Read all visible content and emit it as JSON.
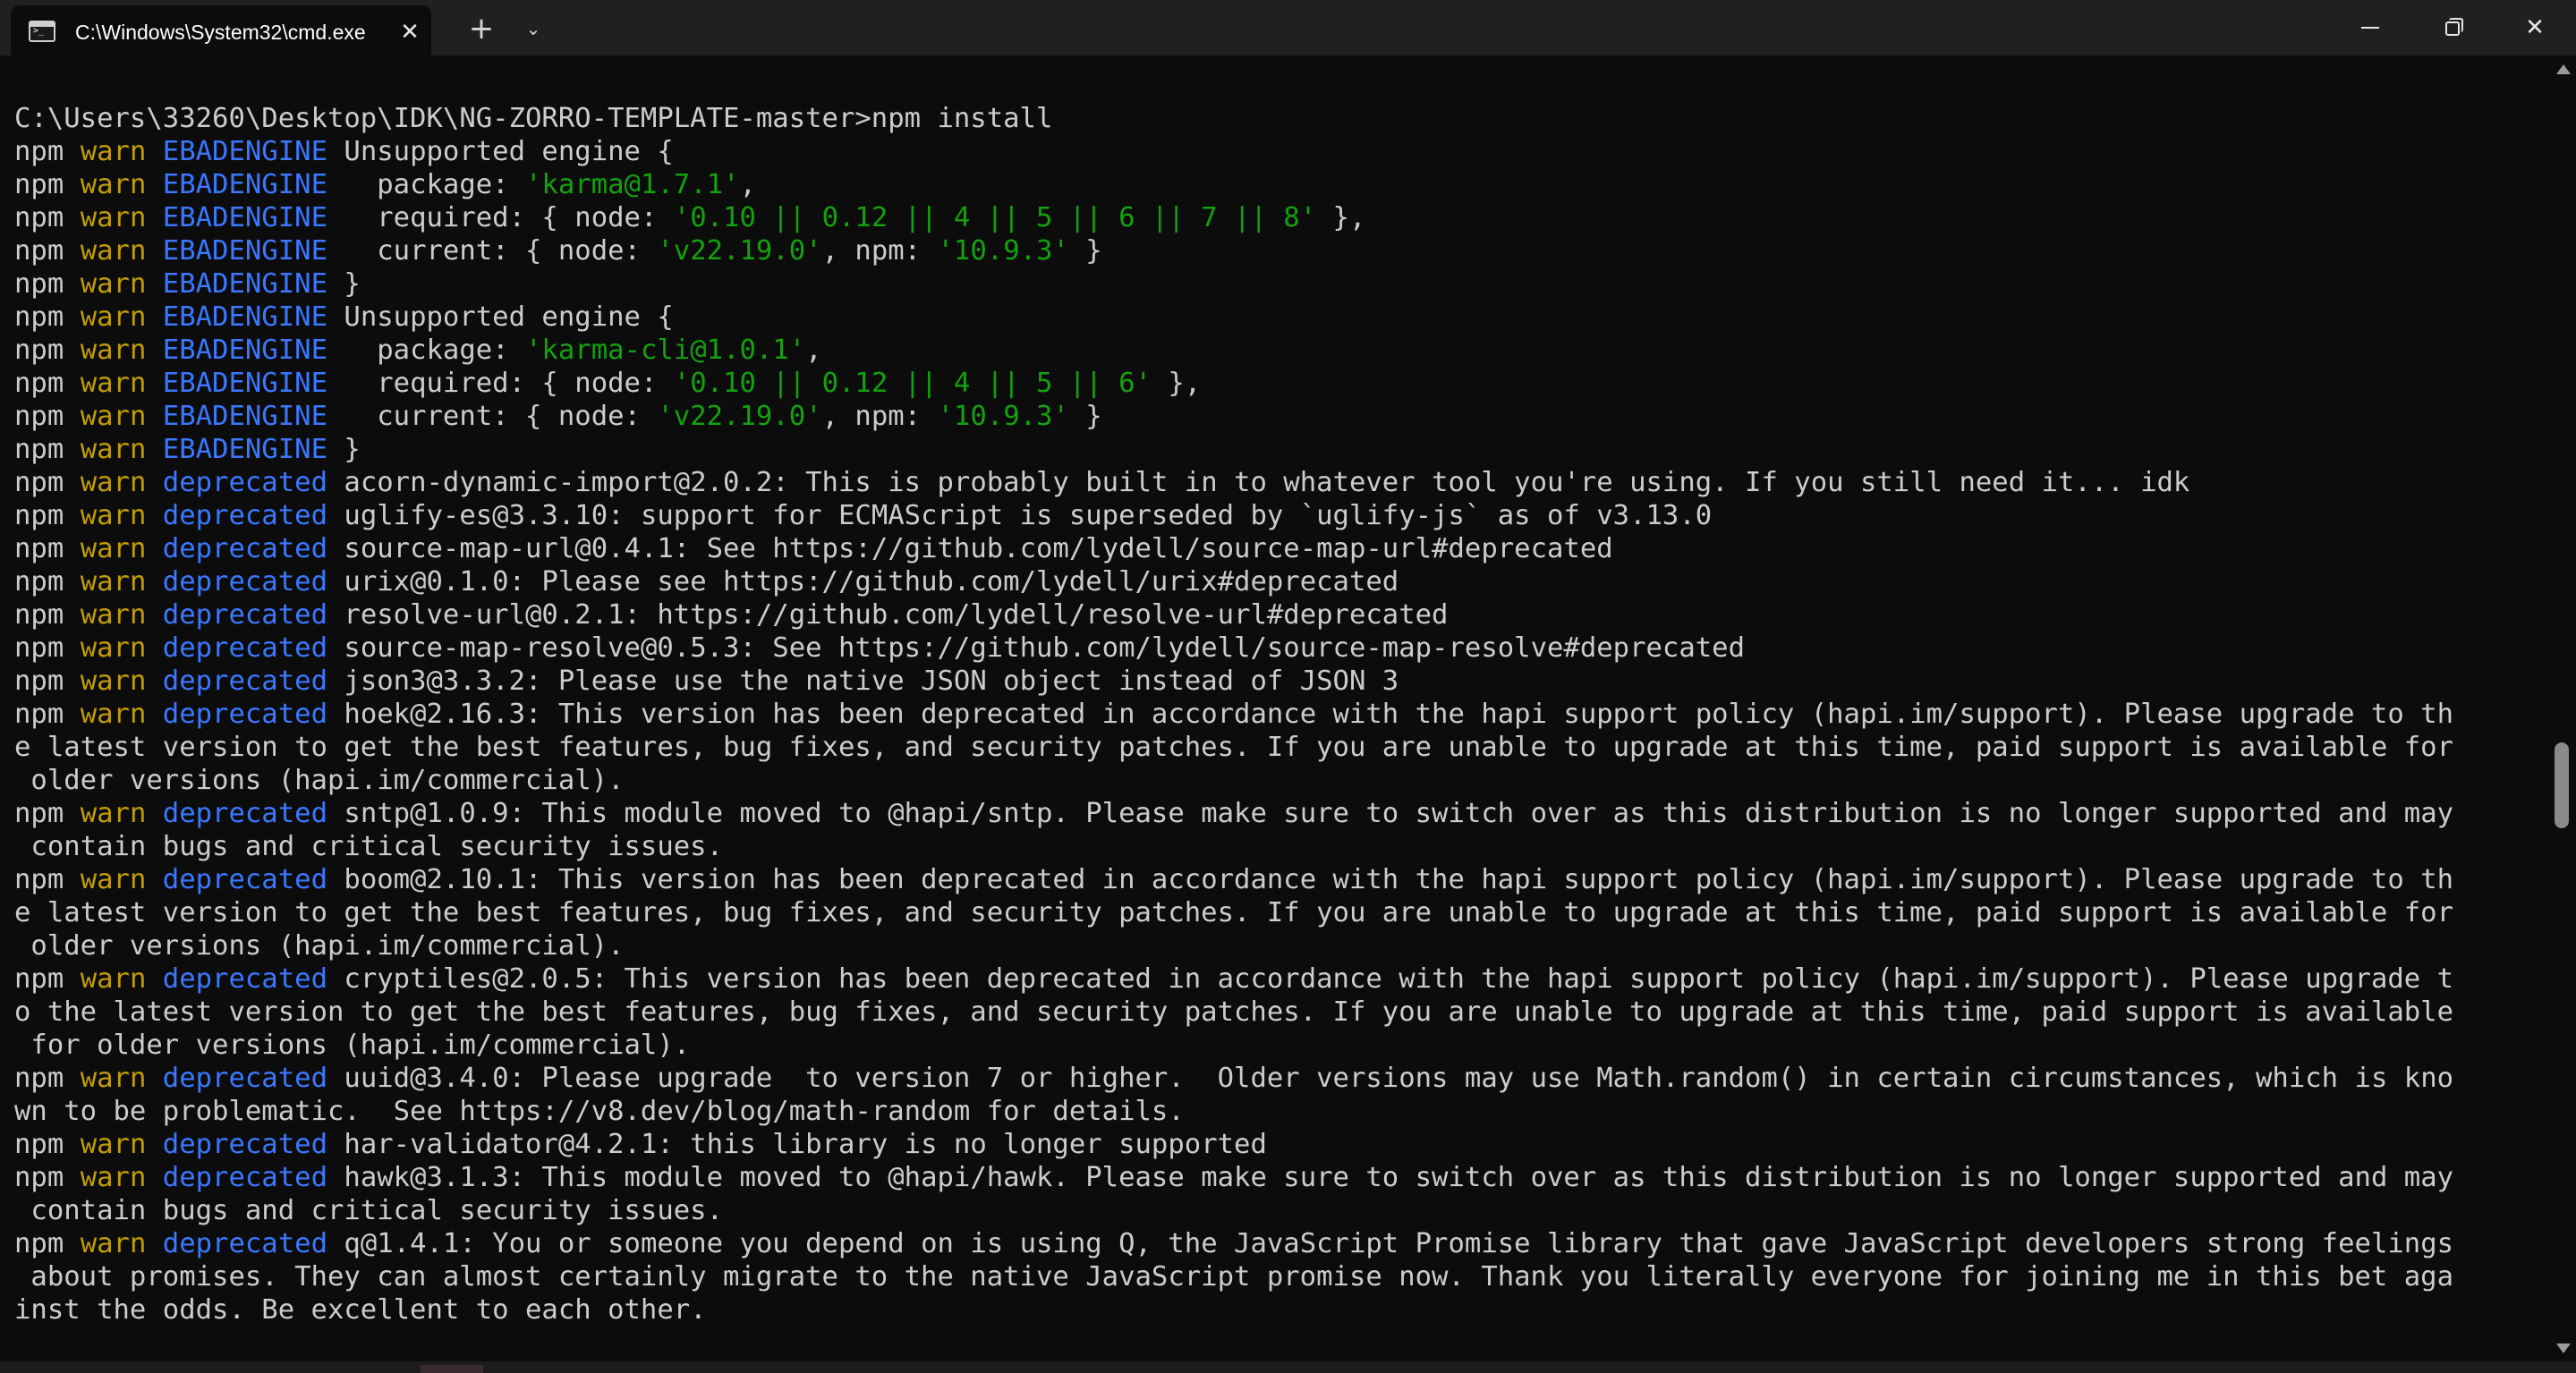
{
  "window": {
    "tab_title": "C:\\Windows\\System32\\cmd.exe",
    "tab_icon": "terminal-icon",
    "close_tab_icon": "✕",
    "new_tab_icon": "+",
    "dropdown_icon": "⌄",
    "close_window_icon": "✕"
  },
  "colors": {
    "background": "#0c0c0c",
    "titlebar": "#202020",
    "npm": "#cccccc",
    "warn": "#c19c00",
    "code": "#3b78ff",
    "string": "#13a10e"
  },
  "terminal": {
    "lines": [
      {
        "type": "plain",
        "text": "C:\\Users\\33260\\Desktop\\IDK\\NG-ZORRO-TEMPLATE-master>npm install"
      },
      {
        "type": "warn",
        "code": "EBADENGINE",
        "segments": [
          {
            "t": "Unsupported engine {"
          }
        ]
      },
      {
        "type": "warn",
        "code": "EBADENGINE",
        "segments": [
          {
            "t": "  package: "
          },
          {
            "t": "'karma@1.7.1'",
            "s": true
          },
          {
            "t": ","
          }
        ]
      },
      {
        "type": "warn",
        "code": "EBADENGINE",
        "segments": [
          {
            "t": "  required: { node: "
          },
          {
            "t": "'0.10 || 0.12 || 4 || 5 || 6 || 7 || 8'",
            "s": true
          },
          {
            "t": " },"
          }
        ]
      },
      {
        "type": "warn",
        "code": "EBADENGINE",
        "segments": [
          {
            "t": "  current: { node: "
          },
          {
            "t": "'v22.19.0'",
            "s": true
          },
          {
            "t": ", npm: "
          },
          {
            "t": "'10.9.3'",
            "s": true
          },
          {
            "t": " }"
          }
        ]
      },
      {
        "type": "warn",
        "code": "EBADENGINE",
        "segments": [
          {
            "t": "}"
          }
        ]
      },
      {
        "type": "warn",
        "code": "EBADENGINE",
        "segments": [
          {
            "t": "Unsupported engine {"
          }
        ]
      },
      {
        "type": "warn",
        "code": "EBADENGINE",
        "segments": [
          {
            "t": "  package: "
          },
          {
            "t": "'karma-cli@1.0.1'",
            "s": true
          },
          {
            "t": ","
          }
        ]
      },
      {
        "type": "warn",
        "code": "EBADENGINE",
        "segments": [
          {
            "t": "  required: { node: "
          },
          {
            "t": "'0.10 || 0.12 || 4 || 5 || 6'",
            "s": true
          },
          {
            "t": " },"
          }
        ]
      },
      {
        "type": "warn",
        "code": "EBADENGINE",
        "segments": [
          {
            "t": "  current: { node: "
          },
          {
            "t": "'v22.19.0'",
            "s": true
          },
          {
            "t": ", npm: "
          },
          {
            "t": "'10.9.3'",
            "s": true
          },
          {
            "t": " }"
          }
        ]
      },
      {
        "type": "warn",
        "code": "EBADENGINE",
        "segments": [
          {
            "t": "}"
          }
        ]
      },
      {
        "type": "warn",
        "code": "deprecated",
        "segments": [
          {
            "t": "acorn-dynamic-import@2.0.2: This is probably built in to whatever tool you're using. If you still need it... idk"
          }
        ]
      },
      {
        "type": "warn",
        "code": "deprecated",
        "segments": [
          {
            "t": "uglify-es@3.3.10: support for ECMAScript is superseded by `uglify-js` as of v3.13.0"
          }
        ]
      },
      {
        "type": "warn",
        "code": "deprecated",
        "segments": [
          {
            "t": "source-map-url@0.4.1: See https://github.com/lydell/source-map-url#deprecated"
          }
        ]
      },
      {
        "type": "warn",
        "code": "deprecated",
        "segments": [
          {
            "t": "urix@0.1.0: Please see https://github.com/lydell/urix#deprecated"
          }
        ]
      },
      {
        "type": "warn",
        "code": "deprecated",
        "segments": [
          {
            "t": "resolve-url@0.2.1: https://github.com/lydell/resolve-url#deprecated"
          }
        ]
      },
      {
        "type": "warn",
        "code": "deprecated",
        "segments": [
          {
            "t": "source-map-resolve@0.5.3: See https://github.com/lydell/source-map-resolve#deprecated"
          }
        ]
      },
      {
        "type": "warn",
        "code": "deprecated",
        "segments": [
          {
            "t": "json3@3.3.2: Please use the native JSON object instead of JSON 3"
          }
        ]
      },
      {
        "type": "warn",
        "code": "deprecated",
        "segments": [
          {
            "t": "hoek@2.16.3: This version has been deprecated in accordance with the hapi support policy (hapi.im/support). Please upgrade to th"
          }
        ]
      },
      {
        "type": "plain",
        "text": "e latest version to get the best features, bug fixes, and security patches. If you are unable to upgrade at this time, paid support is available for"
      },
      {
        "type": "plain",
        "text": " older versions (hapi.im/commercial)."
      },
      {
        "type": "warn",
        "code": "deprecated",
        "segments": [
          {
            "t": "sntp@1.0.9: This module moved to @hapi/sntp. Please make sure to switch over as this distribution is no longer supported and may"
          }
        ]
      },
      {
        "type": "plain",
        "text": " contain bugs and critical security issues."
      },
      {
        "type": "warn",
        "code": "deprecated",
        "segments": [
          {
            "t": "boom@2.10.1: This version has been deprecated in accordance with the hapi support policy (hapi.im/support). Please upgrade to th"
          }
        ]
      },
      {
        "type": "plain",
        "text": "e latest version to get the best features, bug fixes, and security patches. If you are unable to upgrade at this time, paid support is available for"
      },
      {
        "type": "plain",
        "text": " older versions (hapi.im/commercial)."
      },
      {
        "type": "warn",
        "code": "deprecated",
        "segments": [
          {
            "t": "cryptiles@2.0.5: This version has been deprecated in accordance with the hapi support policy (hapi.im/support). Please upgrade t"
          }
        ]
      },
      {
        "type": "plain",
        "text": "o the latest version to get the best features, bug fixes, and security patches. If you are unable to upgrade at this time, paid support is available"
      },
      {
        "type": "plain",
        "text": " for older versions (hapi.im/commercial)."
      },
      {
        "type": "warn",
        "code": "deprecated",
        "segments": [
          {
            "t": "uuid@3.4.0: Please upgrade  to version 7 or higher.  Older versions may use Math.random() in certain circumstances, which is kno"
          }
        ]
      },
      {
        "type": "plain",
        "text": "wn to be problematic.  See https://v8.dev/blog/math-random for details."
      },
      {
        "type": "warn",
        "code": "deprecated",
        "segments": [
          {
            "t": "har-validator@4.2.1: this library is no longer supported"
          }
        ]
      },
      {
        "type": "warn",
        "code": "deprecated",
        "segments": [
          {
            "t": "hawk@3.1.3: This module moved to @hapi/hawk. Please make sure to switch over as this distribution is no longer supported and may"
          }
        ]
      },
      {
        "type": "plain",
        "text": " contain bugs and critical security issues."
      },
      {
        "type": "warn",
        "code": "deprecated",
        "segments": [
          {
            "t": "q@1.4.1: You or someone you depend on is using Q, the JavaScript Promise library that gave JavaScript developers strong feelings"
          }
        ]
      },
      {
        "type": "plain",
        "text": " about promises. They can almost certainly migrate to the native JavaScript promise now. Thank you literally everyone for joining me in this bet aga"
      },
      {
        "type": "plain",
        "text": "inst the odds. Be excellent to each other."
      }
    ],
    "prefix_npm": "npm",
    "prefix_warn": "warn"
  }
}
